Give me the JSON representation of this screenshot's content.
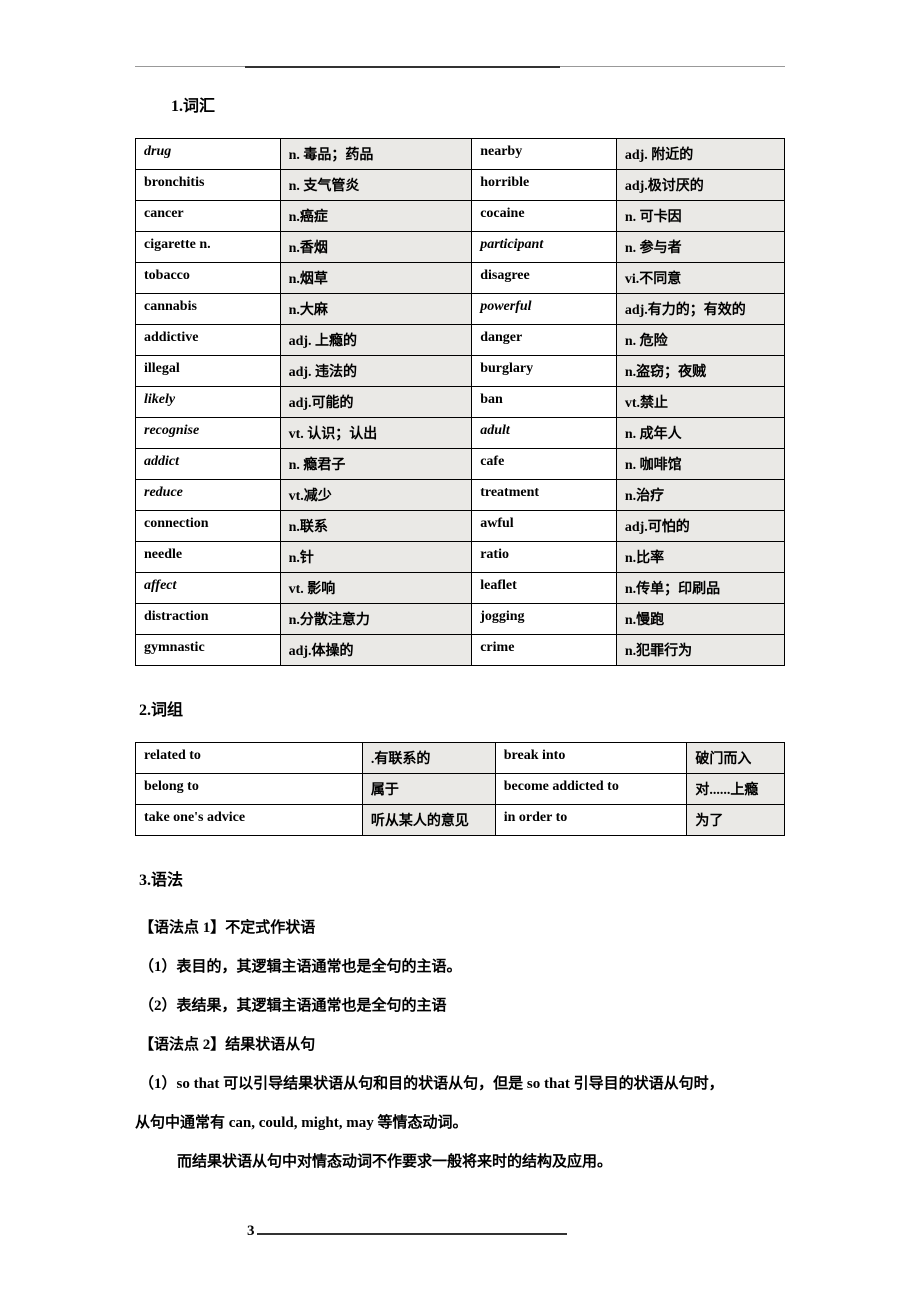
{
  "sections": {
    "s1": "1.词汇",
    "s2": "2.词组",
    "s3": "3.语法"
  },
  "vocab": [
    {
      "w1": "drug",
      "w1i": true,
      "d1": "n. 毒品；药品",
      "w2": "nearby",
      "w2i": false,
      "d2": "adj. 附近的"
    },
    {
      "w1": "bronchitis",
      "w1i": false,
      "d1": "n. 支气管炎",
      "w2": "horrible",
      "w2i": false,
      "d2": "adj.极讨厌的"
    },
    {
      "w1": "cancer",
      "w1i": false,
      "d1": "n.癌症",
      "w2": "cocaine",
      "w2i": false,
      "d2": "n. 可卡因"
    },
    {
      "w1": "cigarette n.",
      "w1i": false,
      "d1": "n.香烟",
      "w2": "participant",
      "w2i": true,
      "d2": "n. 参与者"
    },
    {
      "w1": "tobacco",
      "w1i": false,
      "d1": "n.烟草",
      "w2": "disagree",
      "w2i": false,
      "d2": "vi.不同意"
    },
    {
      "w1": "cannabis",
      "w1i": false,
      "d1": "n.大麻",
      "w2": "powerful",
      "w2i": true,
      "d2": "adj.有力的；有效的"
    },
    {
      "w1": "addictive",
      "w1i": false,
      "d1": "adj. 上瘾的",
      "w2": "danger",
      "w2i": false,
      "d2": "n. 危险"
    },
    {
      "w1": "illegal",
      "w1i": false,
      "d1": "adj. 违法的",
      "w2": "burglary",
      "w2i": false,
      "d2": "n.盗窃；夜贼"
    },
    {
      "w1": "likely",
      "w1i": true,
      "d1": "adj.可能的",
      "w2": "ban",
      "w2i": false,
      "d2": "vt.禁止"
    },
    {
      "w1": "recognise",
      "w1i": true,
      "d1": "vt. 认识；认出",
      "w2": "adult",
      "w2i": true,
      "d2": "n. 成年人"
    },
    {
      "w1": "addict",
      "w1i": true,
      "d1": "n. 瘾君子",
      "w2": "cafe",
      "w2i": false,
      "d2": "n. 咖啡馆"
    },
    {
      "w1": "reduce",
      "w1i": true,
      "d1": "vt.减少",
      "w2": "treatment",
      "w2i": false,
      "d2": "n.治疗"
    },
    {
      "w1": "connection",
      "w1i": false,
      "d1": "n.联系",
      "w2": "awful",
      "w2i": false,
      "d2": "adj.可怕的"
    },
    {
      "w1": "needle",
      "w1i": false,
      "d1": "n.针",
      "w2": "ratio",
      "w2i": false,
      "d2": "n.比率"
    },
    {
      "w1": "affect",
      "w1i": true,
      "d1": "vt. 影响",
      "w2": "leaflet",
      "w2i": false,
      "d2": "n.传单；印刷品"
    },
    {
      "w1": "distraction",
      "w1i": false,
      "d1": "n.分散注意力",
      "w2": "jogging",
      "w2i": false,
      "d2": "n.慢跑"
    },
    {
      "w1": "gymnastic",
      "w1i": false,
      "d1": "adj.体操的",
      "w2": "crime",
      "w2i": false,
      "d2": "n.犯罪行为"
    }
  ],
  "phrases": [
    {
      "p1": "related to",
      "m1": ".有联系的",
      "p2": "break into",
      "m2": "破门而入"
    },
    {
      "p1": "belong to",
      "m1": "属于",
      "p2": "become addicted to",
      "m2": "对......上瘾"
    },
    {
      "p1": "take one's advice",
      "m1": "听从某人的意见",
      "p2": "in order to",
      "m2": "为了"
    }
  ],
  "grammar": {
    "g1": "【语法点 1】不定式作状语",
    "g1a": "（1）表目的，其逻辑主语通常也是全句的主语。",
    "g1b": "（2）表结果，其逻辑主语通常也是全句的主语",
    "g2": "【语法点 2】结果状语从句",
    "g2a": "（1）so that 可以引导结果状语从句和目的状语从句，但是 so that 引导目的状语从句时，",
    "g2b": "从句中通常有 can, could, might, may 等情态动词。",
    "g2c": "而结果状语从句中对情态动词不作要求一般将来时的结构及应用。"
  },
  "pagenum": "3"
}
